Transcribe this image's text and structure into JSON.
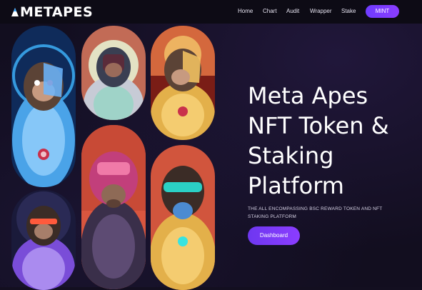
{
  "brand": {
    "logo_text": "METAPES"
  },
  "nav": {
    "links": [
      {
        "label": "Home"
      },
      {
        "label": "Chart"
      },
      {
        "label": "Audit"
      },
      {
        "label": "Wrapper"
      },
      {
        "label": "Stake"
      }
    ],
    "mint_label": "MINT"
  },
  "hero": {
    "title_lines": [
      "Meta Apes",
      "NFT Token &",
      "Staking",
      "Platform"
    ],
    "subtitle_lines": [
      "THE ALL ENCOMPASSING BSC REWARD TOKEN AND NFT",
      "STAKING PLATFORM"
    ],
    "cta_label": "Dashboard"
  },
  "gallery": {
    "cards": [
      {
        "name": "nft-card-blue-cyborg-ape",
        "accent": "#4aa3e8",
        "bg": "#0f2b5a"
      },
      {
        "name": "nft-card-purple-ape",
        "accent": "#7a4dd8",
        "bg": "#1a1a3a"
      },
      {
        "name": "nft-card-silver-robot-ape",
        "accent": "#c7cbd6",
        "bg": "#c26b56"
      },
      {
        "name": "nft-card-pink-helmet-ape",
        "accent": "#e04a8a",
        "bg": "#d9563f"
      },
      {
        "name": "nft-card-gold-armor-ape",
        "accent": "#e3b04a",
        "bg": "#7a1d16"
      },
      {
        "name": "nft-card-gold-visor-ape",
        "accent": "#f0c040",
        "bg": "#d1553d"
      }
    ]
  }
}
